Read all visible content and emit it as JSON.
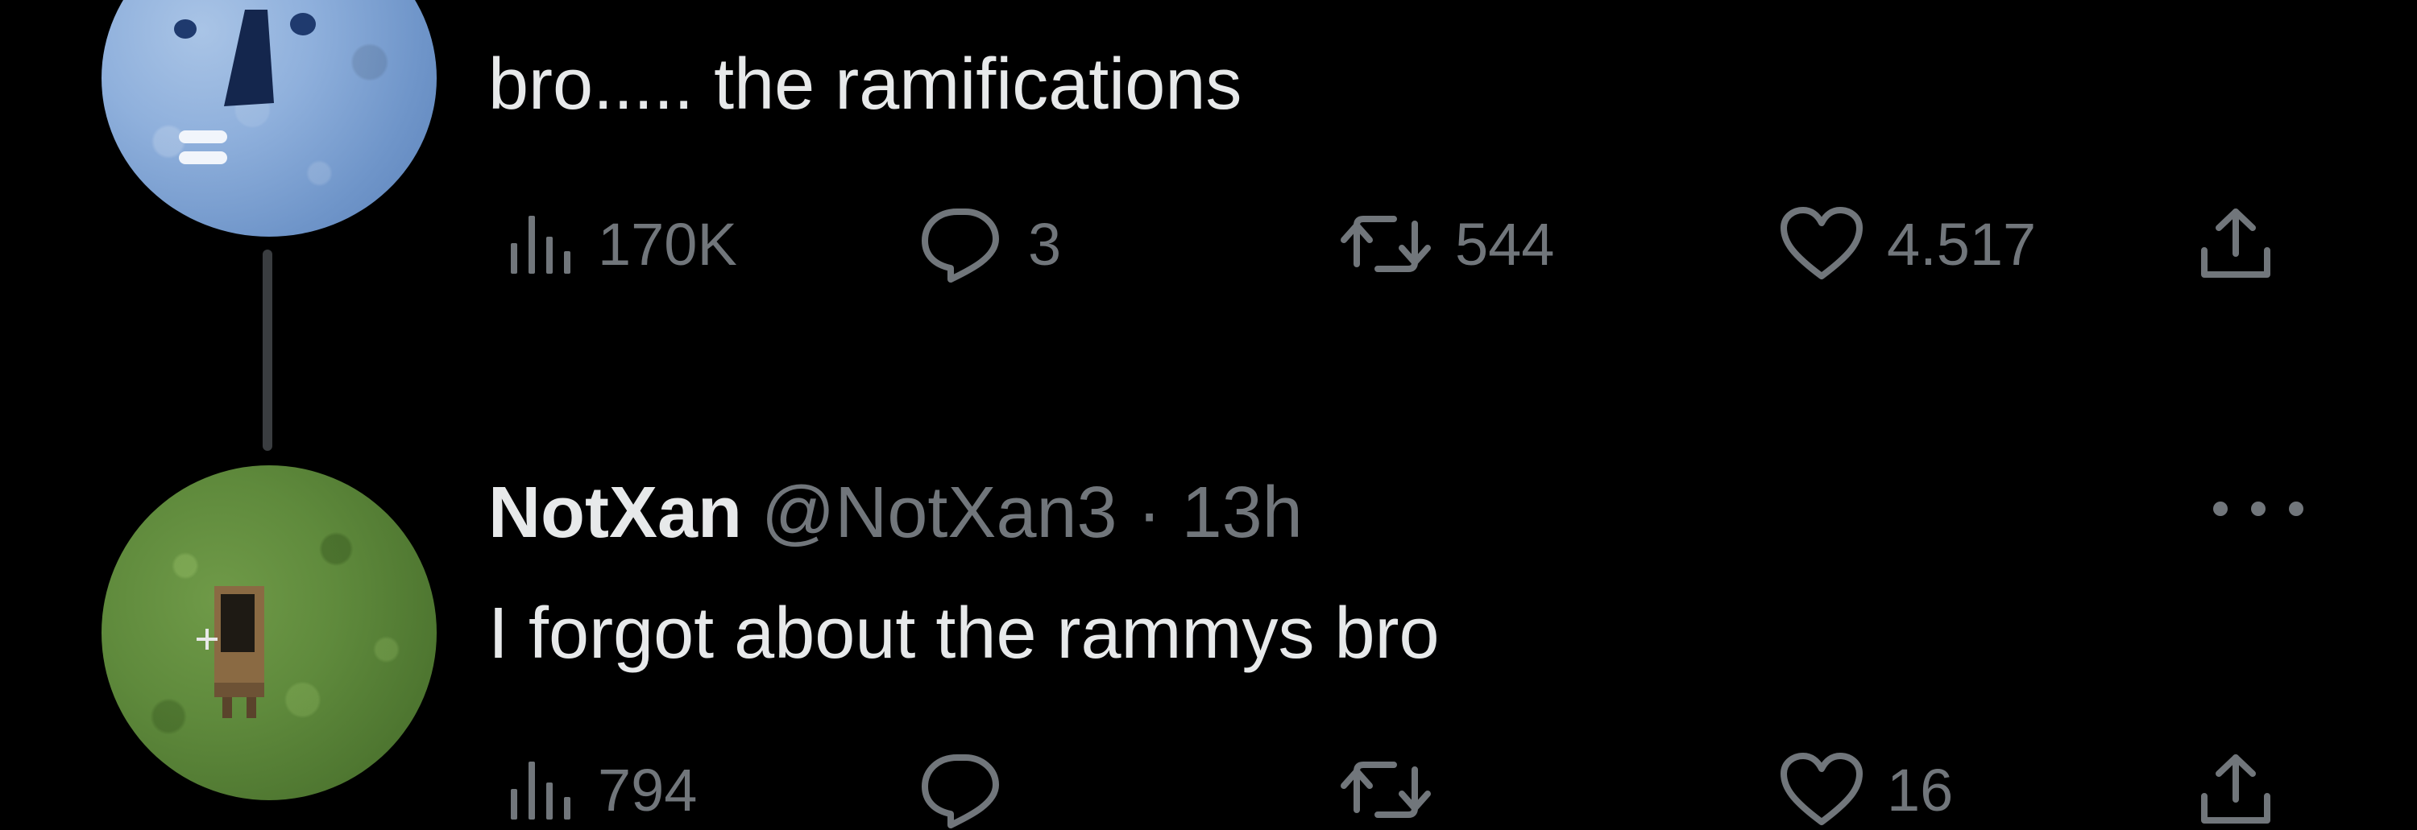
{
  "tweets": [
    {
      "text": "bro..... the ramifications",
      "avatar_icon": "moon-face-avatar",
      "metrics": {
        "views": "170K",
        "replies": "3",
        "retweets": "544",
        "likes": "4.517"
      }
    },
    {
      "display_name": "NotXan",
      "handle": "@NotXan3",
      "separator": "·",
      "time": "13h",
      "text": "I forgot about the rammys bro",
      "avatar_icon": "grass-block-avatar",
      "metrics": {
        "views": "794",
        "likes": "16"
      }
    }
  ],
  "colors": {
    "background": "#000000",
    "primary_text": "#e7e9ea",
    "secondary_text": "#71767b",
    "thread_line": "#3a3d40"
  }
}
